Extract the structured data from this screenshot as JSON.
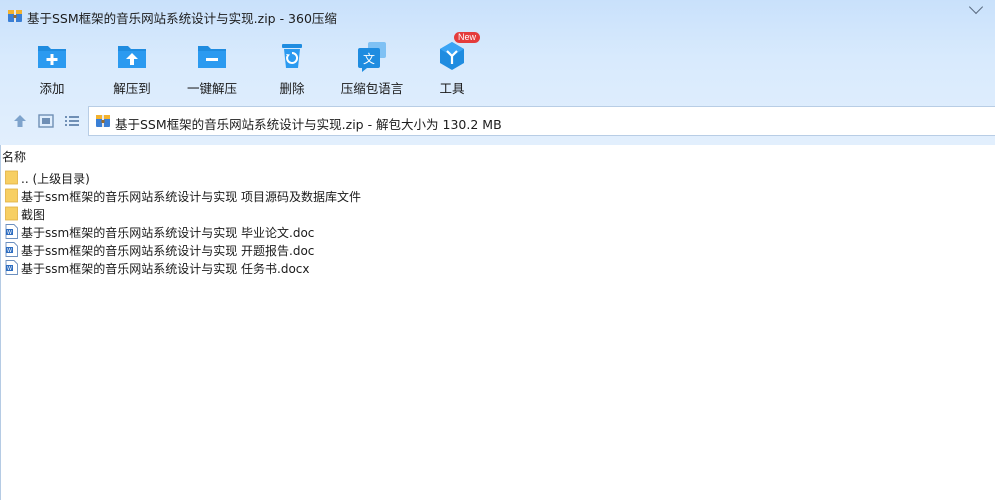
{
  "window": {
    "title": "基于SSM框架的音乐网站系统设计与实现.zip - 360压缩"
  },
  "toolbar": {
    "items": [
      {
        "label": "添加",
        "icon": "add-folder-icon"
      },
      {
        "label": "解压到",
        "icon": "extract-to-icon"
      },
      {
        "label": "一键解压",
        "icon": "one-click-extract-icon"
      },
      {
        "label": "删除",
        "icon": "recycle-bin-icon"
      },
      {
        "label": "压缩包语言",
        "icon": "language-icon"
      },
      {
        "label": "工具",
        "icon": "tools-icon",
        "badge": "New"
      }
    ]
  },
  "navbar": {
    "address": "基于SSM框架的音乐网站系统设计与实现.zip - 解包大小为 130.2 MB"
  },
  "list": {
    "column_name": "名称",
    "rows": [
      {
        "name": ".. (上级目录)",
        "type": "folder"
      },
      {
        "name": "基于ssm框架的音乐网站系统设计与实现 项目源码及数据库文件",
        "type": "folder"
      },
      {
        "name": "截图",
        "type": "folder"
      },
      {
        "name": "基于ssm框架的音乐网站系统设计与实现 毕业论文.doc",
        "type": "doc"
      },
      {
        "name": "基于ssm框架的音乐网站系统设计与实现 开题报告.doc",
        "type": "doc"
      },
      {
        "name": "基于ssm框架的音乐网站系统设计与实现 任务书.docx",
        "type": "doc"
      }
    ]
  },
  "colors": {
    "accent": "#1f8ce0",
    "header_bg": "#d8eafd",
    "folder": "#f7cf63"
  }
}
